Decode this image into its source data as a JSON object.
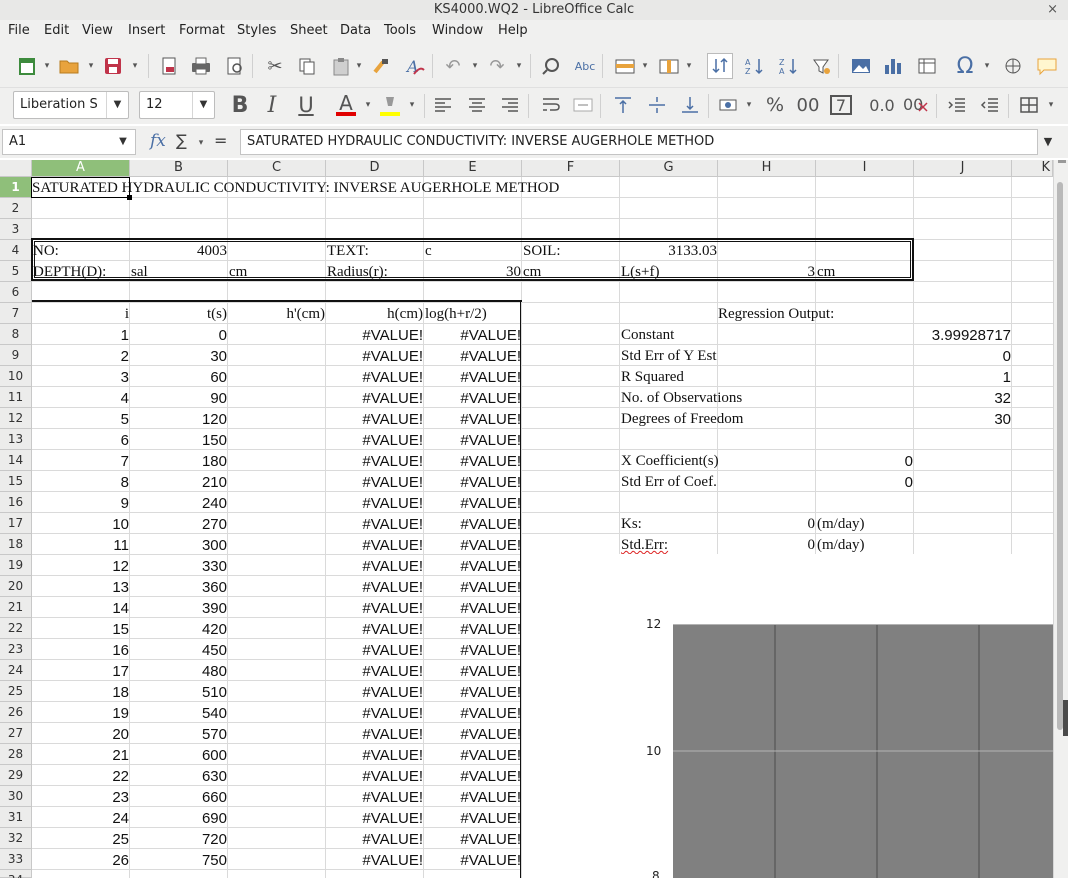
{
  "window": {
    "title": "KS4000.WQ2 - LibreOffice Calc",
    "close": "×"
  },
  "menu": [
    "File",
    "Edit",
    "View",
    "Insert",
    "Format",
    "Styles",
    "Sheet",
    "Data",
    "Tools",
    "Window",
    "Help"
  ],
  "toolbar": {
    "font_name": "Liberation S",
    "font_size": "12",
    "bold": "B",
    "italic": "I",
    "underline": "U",
    "font_color": "A",
    "percent": "%",
    "decimal": "0.0",
    "number": "00",
    "seven": "7",
    "omega": "Ω",
    "abc": "Abc",
    "colors": {
      "font_color_bar": "#e00000",
      "highlight_bar": "#ffff00"
    }
  },
  "formula_bar": {
    "cell_ref": "A1",
    "fx": "fx",
    "sum": "∑",
    "equals": "=",
    "content": "SATURATED HYDRAULIC CONDUCTIVITY: INVERSE AUGERHOLE METHOD"
  },
  "columns": [
    "A",
    "B",
    "C",
    "D",
    "E",
    "F",
    "G",
    "H",
    "I",
    "J",
    "K"
  ],
  "rows": [
    "1",
    "2",
    "3",
    "4",
    "5",
    "6",
    "7",
    "8",
    "9",
    "10",
    "11",
    "12",
    "13",
    "14",
    "15",
    "16",
    "17",
    "18",
    "19",
    "20",
    "21",
    "22",
    "23",
    "24",
    "25",
    "26",
    "27",
    "28",
    "29",
    "30",
    "31",
    "32",
    "33",
    "34"
  ],
  "sheet": {
    "title": "SATURATED HYDRAULIC CONDUCTIVITY: INVERSE AUGERHOLE METHOD",
    "r4": {
      "no_label": "NO:",
      "no_value": "4003",
      "text_label": "TEXT:",
      "text_value": "c",
      "soil_label": "SOIL:",
      "soil_value": "3133.03"
    },
    "r5": {
      "depth_label": "DEPTH(D):",
      "depth_value": "sal",
      "depth_unit": "cm",
      "radius_label": "Radius(r):",
      "radius_value": "30",
      "radius_unit": "cm",
      "l_label": "L(s+f)",
      "l_value": "3",
      "l_unit": "cm"
    },
    "headers": {
      "i": "i",
      "ts": "t(s)",
      "hprime": "h'(cm)",
      "hcm": "h(cm)",
      "log": "log(h+r/2)"
    },
    "data_rows": [
      {
        "i": "1",
        "t": "0",
        "d": "#VALUE!",
        "e": "#VALUE!"
      },
      {
        "i": "2",
        "t": "30",
        "d": "#VALUE!",
        "e": "#VALUE!"
      },
      {
        "i": "3",
        "t": "60",
        "d": "#VALUE!",
        "e": "#VALUE!"
      },
      {
        "i": "4",
        "t": "90",
        "d": "#VALUE!",
        "e": "#VALUE!"
      },
      {
        "i": "5",
        "t": "120",
        "d": "#VALUE!",
        "e": "#VALUE!"
      },
      {
        "i": "6",
        "t": "150",
        "d": "#VALUE!",
        "e": "#VALUE!"
      },
      {
        "i": "7",
        "t": "180",
        "d": "#VALUE!",
        "e": "#VALUE!"
      },
      {
        "i": "8",
        "t": "210",
        "d": "#VALUE!",
        "e": "#VALUE!"
      },
      {
        "i": "9",
        "t": "240",
        "d": "#VALUE!",
        "e": "#VALUE!"
      },
      {
        "i": "10",
        "t": "270",
        "d": "#VALUE!",
        "e": "#VALUE!"
      },
      {
        "i": "11",
        "t": "300",
        "d": "#VALUE!",
        "e": "#VALUE!"
      },
      {
        "i": "12",
        "t": "330",
        "d": "#VALUE!",
        "e": "#VALUE!"
      },
      {
        "i": "13",
        "t": "360",
        "d": "#VALUE!",
        "e": "#VALUE!"
      },
      {
        "i": "14",
        "t": "390",
        "d": "#VALUE!",
        "e": "#VALUE!"
      },
      {
        "i": "15",
        "t": "420",
        "d": "#VALUE!",
        "e": "#VALUE!"
      },
      {
        "i": "16",
        "t": "450",
        "d": "#VALUE!",
        "e": "#VALUE!"
      },
      {
        "i": "17",
        "t": "480",
        "d": "#VALUE!",
        "e": "#VALUE!"
      },
      {
        "i": "18",
        "t": "510",
        "d": "#VALUE!",
        "e": "#VALUE!"
      },
      {
        "i": "19",
        "t": "540",
        "d": "#VALUE!",
        "e": "#VALUE!"
      },
      {
        "i": "20",
        "t": "570",
        "d": "#VALUE!",
        "e": "#VALUE!"
      },
      {
        "i": "21",
        "t": "600",
        "d": "#VALUE!",
        "e": "#VALUE!"
      },
      {
        "i": "22",
        "t": "630",
        "d": "#VALUE!",
        "e": "#VALUE!"
      },
      {
        "i": "23",
        "t": "660",
        "d": "#VALUE!",
        "e": "#VALUE!"
      },
      {
        "i": "24",
        "t": "690",
        "d": "#VALUE!",
        "e": "#VALUE!"
      },
      {
        "i": "25",
        "t": "720",
        "d": "#VALUE!",
        "e": "#VALUE!"
      },
      {
        "i": "26",
        "t": "750",
        "d": "#VALUE!",
        "e": "#VALUE!"
      }
    ],
    "regression": {
      "heading": "Regression Output:",
      "constant_label": "Constant",
      "constant_value": "3.99928717",
      "stderr_y_label": "Std Err of Y Est",
      "stderr_y_value": "0",
      "r2_label": "R Squared",
      "r2_value": "1",
      "nobs_label": "No. of Observations",
      "nobs_value": "32",
      "dof_label": "Degrees of Freedom",
      "dof_value": "30",
      "xcoef_label": "X Coefficient(s)",
      "xcoef_value": "0",
      "stderr_coef_label": "Std Err of Coef.",
      "stderr_coef_value": "0",
      "ks_label": "Ks:",
      "ks_value": "0",
      "ks_unit": "(m/day)",
      "stderr_label": "Std.Err:",
      "stderr_value": "0",
      "stderr_unit": "(m/day)"
    }
  },
  "chart": {
    "y_ticks": [
      "12",
      "10",
      "8"
    ],
    "plot_color": "#808080"
  }
}
